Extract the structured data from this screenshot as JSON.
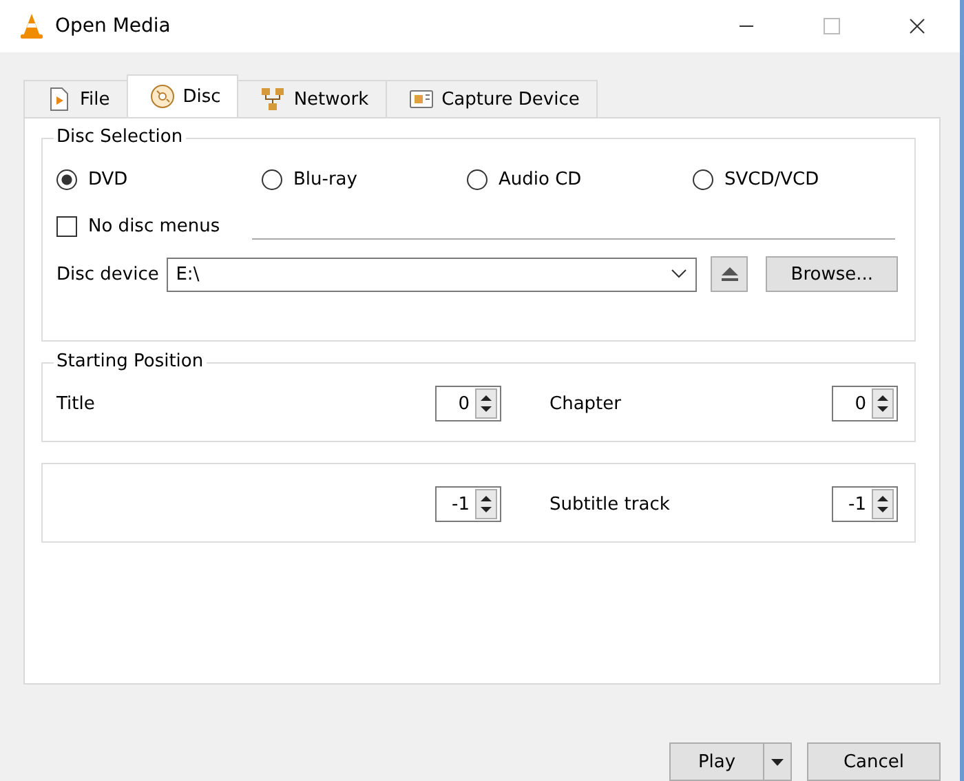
{
  "window": {
    "title": "Open Media"
  },
  "tabs": [
    {
      "label": "File",
      "selected": false
    },
    {
      "label": "Disc",
      "selected": true
    },
    {
      "label": "Network",
      "selected": false
    },
    {
      "label": "Capture Device",
      "selected": false
    }
  ],
  "disc_selection": {
    "title": "Disc Selection",
    "types": [
      {
        "label": "DVD",
        "selected": true
      },
      {
        "label": "Blu-ray",
        "selected": false
      },
      {
        "label": "Audio CD",
        "selected": false
      },
      {
        "label": "SVCD/VCD",
        "selected": false
      }
    ],
    "no_disc_menus": {
      "label": "No disc menus",
      "checked": false
    },
    "disc_device": {
      "label": "Disc device",
      "value": "E:\\"
    },
    "browse_button": "Browse..."
  },
  "starting_position": {
    "title": "Starting Position",
    "fields": [
      {
        "label": "Title",
        "value": "0"
      },
      {
        "label": "Chapter",
        "value": "0"
      }
    ]
  },
  "tracks": {
    "fields": [
      {
        "value": "-1"
      },
      {
        "label": "Subtitle track",
        "value": "-1"
      }
    ]
  },
  "buttons": {
    "play": "Play",
    "cancel": "Cancel"
  }
}
